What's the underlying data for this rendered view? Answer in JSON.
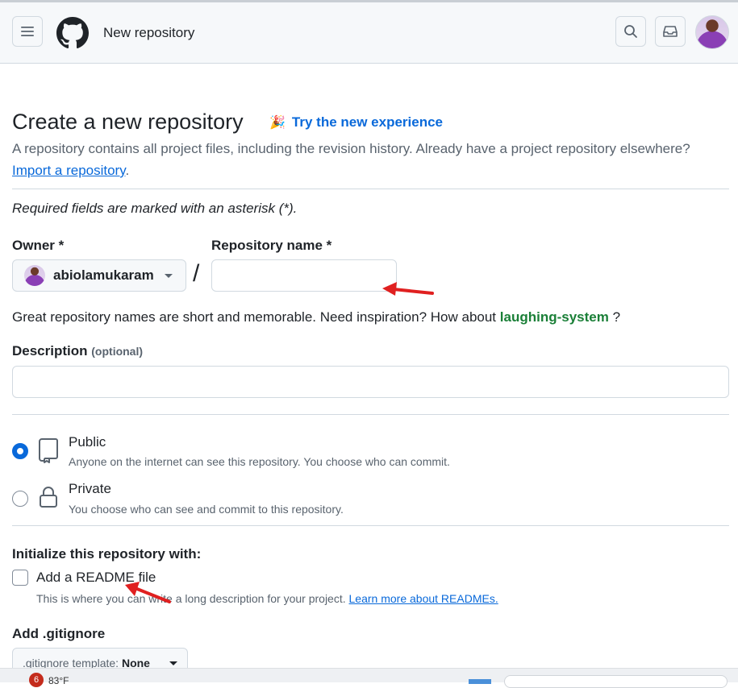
{
  "header": {
    "title": "New repository",
    "menu_icon": "hamburger-menu-icon",
    "logo_icon": "github-logo-icon",
    "search_icon": "search-icon",
    "inbox_icon": "inbox-icon"
  },
  "page": {
    "heading": "Create a new repository",
    "try_new": "Try the new experience",
    "lede": "A repository contains all project files, including the revision history. Already have a project repository elsewhere?",
    "import_link": "Import a repository",
    "import_period": ".",
    "required_note": "Required fields are marked with an asterisk (*)."
  },
  "form": {
    "owner_label": "Owner *",
    "owner_value": "abiolamukaram",
    "repo_name_label": "Repository name *",
    "repo_name_value": "",
    "slash": "/",
    "inspiration_text": "Great repository names are short and memorable. Need inspiration? How about",
    "inspiration_suggestion": "laughing-system",
    "inspiration_end": "?",
    "description_label": "Description",
    "description_optional": "(optional)",
    "description_value": ""
  },
  "visibility": {
    "public": {
      "title": "Public",
      "subtitle": "Anyone on the internet can see this repository. You choose who can commit.",
      "selected": true
    },
    "private": {
      "title": "Private",
      "subtitle": "You choose who can see and commit to this repository.",
      "selected": false
    }
  },
  "initialize": {
    "heading": "Initialize this repository with:",
    "readme_label": "Add a README file",
    "readme_checked": false,
    "readme_sub": "This is where you can write a long description for your project.",
    "readme_link": "Learn more about READMEs.",
    "gitignore_heading": "Add .gitignore",
    "gitignore_select_prefix": ".gitignore template:",
    "gitignore_select_value": "None"
  },
  "taskbar": {
    "badge": "6",
    "temperature": "83°F"
  },
  "colors": {
    "accent": "#0969da",
    "suggestion": "#1a7f37",
    "annotation_arrow": "#e02020"
  }
}
